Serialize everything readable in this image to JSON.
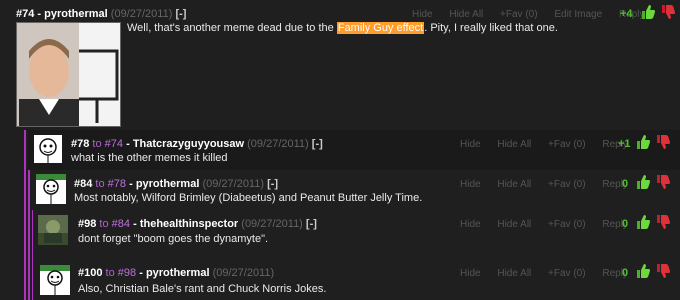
{
  "actions": {
    "hide": "Hide",
    "hide_all": "Hide All",
    "fav": "+Fav (0)",
    "edit": "Edit Image",
    "reply": "Reply"
  },
  "colors": {
    "background": "#1f1f1f",
    "highlight": "#ff9c2b",
    "score_green": "#4cc02a",
    "reply_link_purple": "#c070e0",
    "thread_bar": "#b030c0"
  },
  "comments": [
    {
      "num": "#74",
      "to": "",
      "user": "pyrothermal",
      "date": "(09/27/2011)",
      "bracket": "[-]",
      "text_before": "Well, that's another meme dead due to the ",
      "text_highlight": "Family Guy effect",
      "text_after": ". Pity, I really liked that one.",
      "score": "+4",
      "has_edit": true
    },
    {
      "num": "#78",
      "to_word": "to",
      "to": "#74",
      "user": "Thatcrazyguyyousaw",
      "date": "(09/27/2011)",
      "bracket": "[-]",
      "text": "what is the other memes it killed",
      "score": "+1"
    },
    {
      "num": "#84",
      "to_word": "to",
      "to": "#78",
      "user": "pyrothermal",
      "date": "(09/27/2011)",
      "bracket": "[-]",
      "text": "Most notably, Wilford Brimley (Diabeetus) and Peanut Butter Jelly Time.",
      "score": "0"
    },
    {
      "num": "#98",
      "to_word": "to",
      "to": "#84",
      "user": "thehealthinspector",
      "date": "(09/27/2011)",
      "bracket": "[-]",
      "text": "dont forget \"boom goes the dynamyte\".",
      "score": "0"
    },
    {
      "num": "#100",
      "to_word": "to",
      "to": "#98",
      "user": "pyrothermal",
      "date": "(09/27/2011)",
      "text": "Also, Christian Bale's rant and Chuck Norris Jokes.",
      "score": "0"
    }
  ]
}
